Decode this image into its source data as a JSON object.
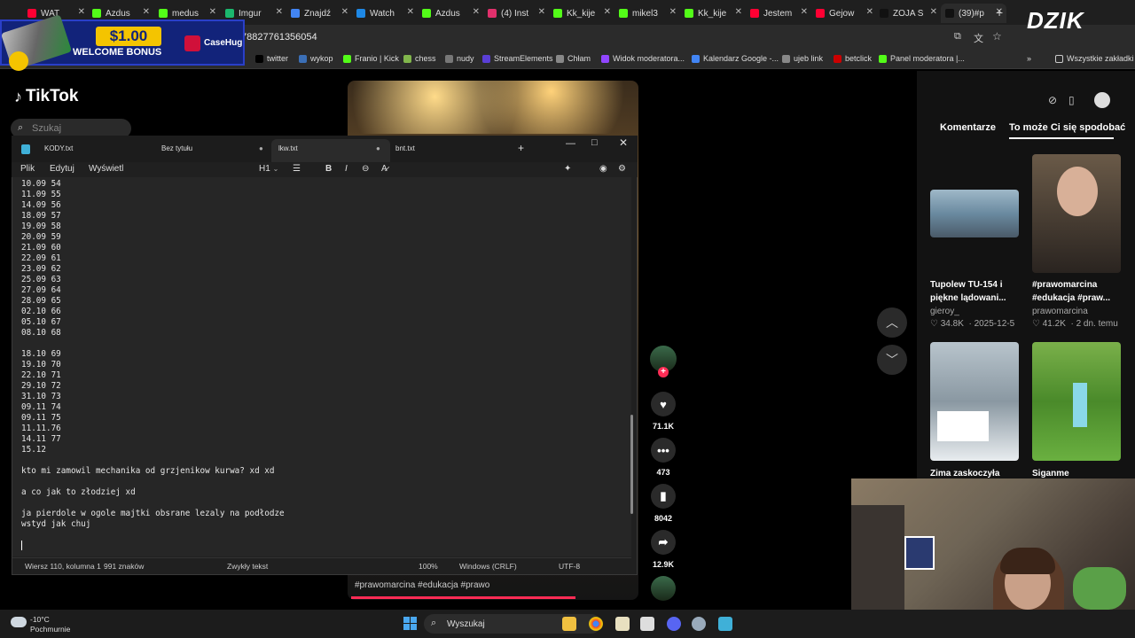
{
  "browser": {
    "tabs": [
      {
        "label": "WAT",
        "color": "#ff0033"
      },
      {
        "label": "Azdus",
        "color": "#53fc18"
      },
      {
        "label": "medus",
        "color": "#53fc18"
      },
      {
        "label": "Imgur",
        "color": "#1bb76e"
      },
      {
        "label": "Znajdź",
        "color": "#4285f4"
      },
      {
        "label": "Watch",
        "color": "#1e88e5"
      },
      {
        "label": "Azdus",
        "color": "#53fc18"
      },
      {
        "label": "(4) Inst",
        "color": "#e1306c"
      },
      {
        "label": "Kk_kije",
        "color": "#53fc18"
      },
      {
        "label": "mikel3",
        "color": "#53fc18"
      },
      {
        "label": "Kk_kije",
        "color": "#53fc18"
      },
      {
        "label": "Jestem",
        "color": "#ff0033"
      },
      {
        "label": "Gejow",
        "color": "#ff0033"
      },
      {
        "label": "ZOJA S",
        "color": "#111111"
      },
      {
        "label": "(39)#p",
        "color": "#111111"
      }
    ],
    "url_fragment": "78827761356054",
    "bookmarks": [
      {
        "label": "twitter",
        "color": "#000000"
      },
      {
        "label": "wykop",
        "color": "#3b6fb6"
      },
      {
        "label": "Franio | Kick",
        "color": "#53fc18"
      },
      {
        "label": "chess",
        "color": "#81b64c"
      },
      {
        "label": "nudy",
        "color": "#777777"
      },
      {
        "label": "StreamElements",
        "color": "#5a3fd6"
      },
      {
        "label": "Chłam",
        "color": "#888888"
      },
      {
        "label": "Widok moderatora...",
        "color": "#9146ff"
      },
      {
        "label": "Kalendarz Google -...",
        "color": "#4285f4"
      },
      {
        "label": "ujeb link",
        "color": "#888888"
      },
      {
        "label": "betclick",
        "color": "#cc0000"
      },
      {
        "label": "Panel moderatora |...",
        "color": "#53fc18"
      }
    ],
    "all_bookmarks": "Wszystkie zakładki"
  },
  "promo": {
    "amount": "$1.00",
    "text": "WELCOME BONUS",
    "brand": "CaseHug"
  },
  "watermark": "DZIK",
  "tiktok": {
    "logo": "TikTok",
    "search_placeholder": "Szukaj",
    "video_tags": "#prawomarcina #edukacja #prawo",
    "progress": 0.77,
    "actions": {
      "likes": "71.1K",
      "comments": "473",
      "saves": "8042",
      "shares": "12.9K"
    },
    "panel_tabs": [
      "Komentarze",
      "To może Ci się spodobać"
    ],
    "recommendations": [
      {
        "title": "Tupolew TU-154 i piękne lądowani...",
        "author": "gieroy_",
        "likes": "34.8K",
        "date": "2025-12-5"
      },
      {
        "title": "#prawomarcina #edukacja #praw...",
        "author": "prawomarcina",
        "likes": "41.2K",
        "date": "2 dn. temu"
      },
      {
        "title": "Zima zaskoczyła",
        "author": "",
        "likes": "",
        "date": ""
      },
      {
        "title": "Siganme",
        "author": "",
        "likes": "",
        "date": ""
      }
    ]
  },
  "notepad": {
    "tabs": [
      "KODY.txt",
      "Bez tytułu",
      "lkw.txt",
      "bnt.txt"
    ],
    "menu": [
      "Plik",
      "Edytuj",
      "Wyświetl"
    ],
    "heading_select": "H1",
    "lines": [
      "10.09 54",
      "11.09 55",
      "14.09 56",
      "18.09 57",
      "19.09 58",
      "20.09 59",
      "21.09 60",
      "22.09 61",
      "23.09 62",
      "25.09 63",
      "27.09 64",
      "28.09 65",
      "02.10 66",
      "05.10 67",
      "08.10 68",
      "",
      "18.10 69",
      "19.10 70",
      "22.10 71",
      "29.10 72",
      "31.10 73",
      "09.11 74",
      "09.11 75",
      "11.11.76",
      "14.11 77",
      "15.12",
      "",
      "kto mi zamowil mechanika od grzjenikow kurwa? xd xd",
      "",
      "a co jak to złodziej xd",
      "",
      "ja pierdole w ogole majtki obsrane lezaly na podłodze",
      "wstyd jak chuj"
    ],
    "status": {
      "position": "Wiersz 110, kolumna 1",
      "chars": "991 znaków",
      "format": "Zwykły tekst",
      "zoom": "100%",
      "line_endings": "Windows (CRLF)",
      "encoding": "UTF-8"
    }
  },
  "taskbar": {
    "temperature": "-10°C",
    "weather": "Pochmurnie",
    "search": "Wyszukaj"
  }
}
